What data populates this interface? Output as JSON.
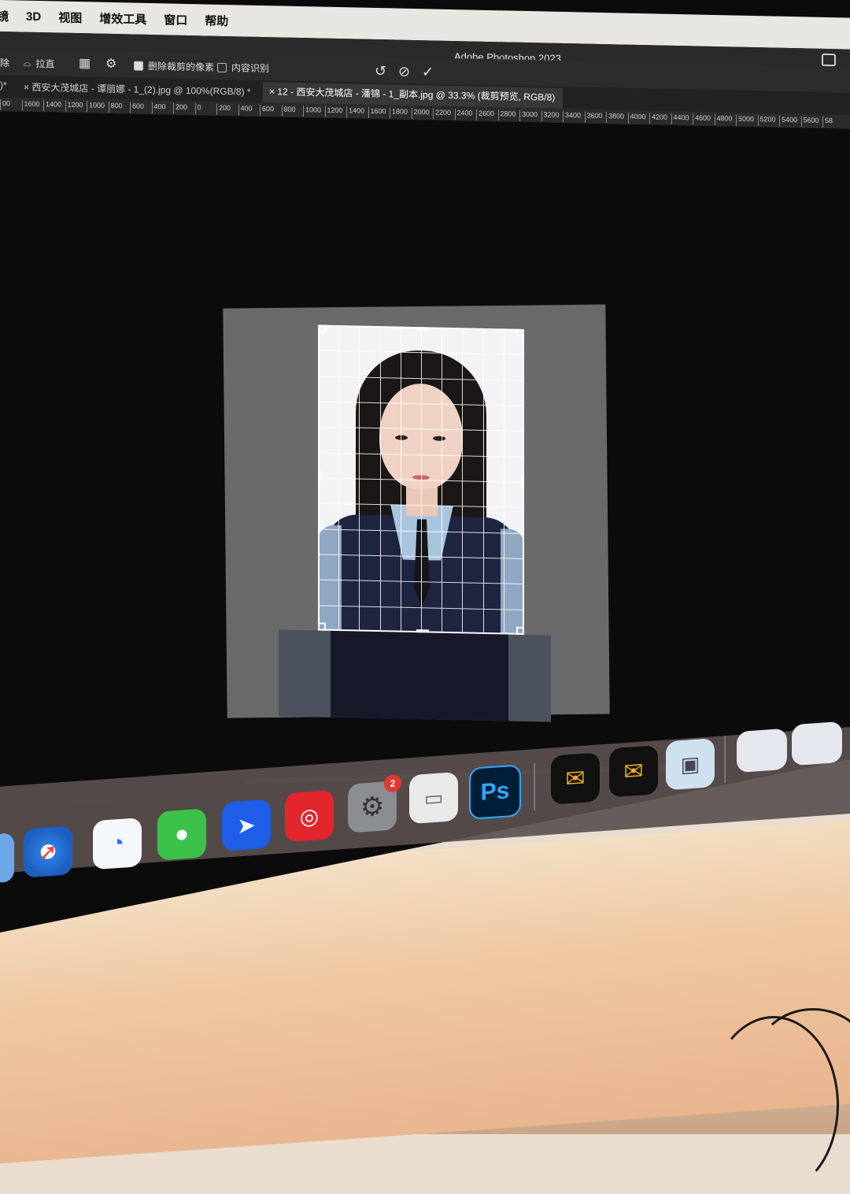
{
  "menubar": {
    "items": [
      "镜",
      "3D",
      "视图",
      "增效工具",
      "窗口",
      "帮助"
    ]
  },
  "titlebar": {
    "title": "Adobe Photoshop 2023"
  },
  "options": {
    "erase_label": "除",
    "straighten_label": "拉直",
    "delete_cropped_label": "删除裁剪的像素",
    "content_aware_label": "内容识别",
    "reset_icon": "rotate-ccw-icon",
    "cancel_icon": "cancel-icon",
    "commit_icon": "check-icon"
  },
  "tabs": [
    {
      "label": ")*"
    },
    {
      "label": "×   西安大茂城店 - 谭丽娜 - 1_(2).jpg @ 100%(RGB/8) *"
    },
    {
      "label": "×   12 - 西安大茂城店 - 潘锦 - 1_副本.jpg @ 33.3% (裁剪预览, RGB/8)"
    }
  ],
  "ruler": [
    "00",
    "1600",
    "1400",
    "1200",
    "1000",
    "800",
    "600",
    "400",
    "200",
    "0",
    "200",
    "400",
    "600",
    "800",
    "1000",
    "1200",
    "1400",
    "1600",
    "1800",
    "2000",
    "2200",
    "2400",
    "2600",
    "2800",
    "3000",
    "3200",
    "3400",
    "3600",
    "3800",
    "4000",
    "4200",
    "4400",
    "4600",
    "4800",
    "5000",
    "5200",
    "5400",
    "5600",
    "58"
  ],
  "dock": {
    "badge_count": "2",
    "ps_label": "Ps",
    "apps": [
      "finder",
      "safari",
      "lark",
      "wechat",
      "feishu",
      "netease-music",
      "system-settings",
      "printer",
      "photoshop",
      "canon-app-1",
      "canon-app-2",
      "preview",
      "screenshot-1",
      "screenshot-2"
    ]
  },
  "colors": {
    "accent_ps": "#31a8ff",
    "ps_bg": "#001e36",
    "badge": "#e0392f"
  }
}
